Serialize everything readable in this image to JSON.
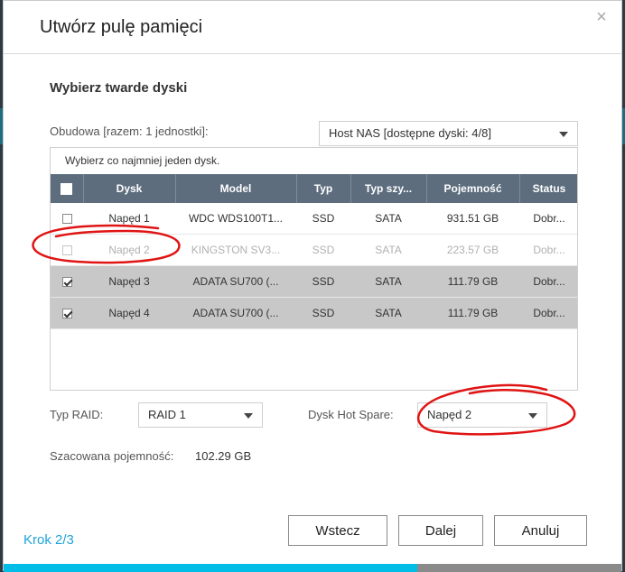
{
  "dialog": {
    "title": "Utwórz pulę pamięci",
    "close_glyph": "×",
    "section_title": "Wybierz twarde dyski"
  },
  "enclosure": {
    "label": "Obudowa [razem: 1 jednostki]:",
    "selected": "Host NAS [dostępne dyski: 4/8]"
  },
  "table": {
    "hint": "Wybierz co najmniej jeden dysk.",
    "columns": [
      "Dysk",
      "Model",
      "Typ",
      "Typ szy...",
      "Pojemność",
      "Status"
    ],
    "rows": [
      {
        "disk": "Napęd 1",
        "model": "WDC WDS100T1...",
        "type": "SSD",
        "bus": "SATA",
        "capacity": "931.51 GB",
        "status": "Dobr...",
        "checked": false,
        "disabled": false
      },
      {
        "disk": "Napęd 2",
        "model": "KINGSTON SV3...",
        "type": "SSD",
        "bus": "SATA",
        "capacity": "223.57 GB",
        "status": "Dobr...",
        "checked": false,
        "disabled": true
      },
      {
        "disk": "Napęd 3",
        "model": "ADATA SU700 (...",
        "type": "SSD",
        "bus": "SATA",
        "capacity": "111.79 GB",
        "status": "Dobr...",
        "checked": true,
        "disabled": false
      },
      {
        "disk": "Napęd 4",
        "model": "ADATA SU700 (...",
        "type": "SSD",
        "bus": "SATA",
        "capacity": "111.79 GB",
        "status": "Dobr...",
        "checked": true,
        "disabled": false
      }
    ]
  },
  "raid": {
    "label": "Typ RAID:",
    "selected": "RAID 1"
  },
  "hot_spare": {
    "label": "Dysk Hot Spare:",
    "selected": "Napęd 2"
  },
  "capacity": {
    "label": "Szacowana pojemność:",
    "value": "102.29 GB"
  },
  "footer": {
    "step": "Krok 2/3",
    "back": "Wstecz",
    "next": "Dalej",
    "cancel": "Anuluj",
    "progress": 0.67
  },
  "colors": {
    "accent": "#00bde8",
    "header_bg": "#5d6d7e",
    "selected_row": "#c8c8c8",
    "annotation": "#e01414"
  }
}
